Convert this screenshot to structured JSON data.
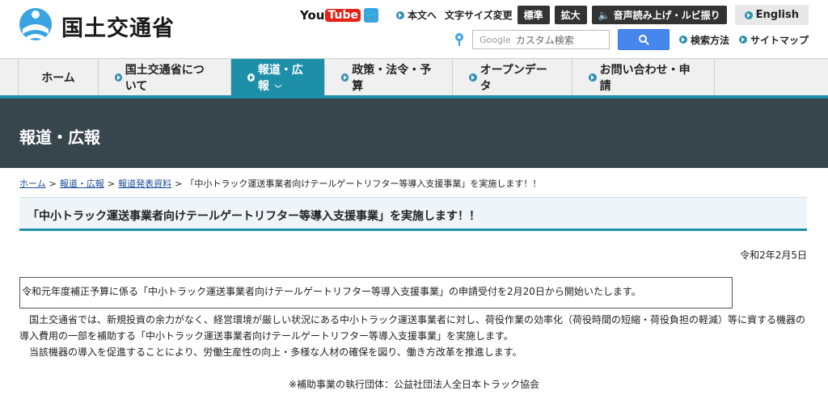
{
  "header": {
    "logo_text": "国土交通省",
    "youtube_you": "You",
    "youtube_tube": "Tube",
    "skip_to_content": "本文へ",
    "font_size_label": "文字サイズ変更",
    "font_standard": "標準",
    "font_large": "拡大",
    "speech_button": "音声読み上げ・ルビ振り",
    "english": "English",
    "search_brand": "Google",
    "search_placeholder": "カスタム検索",
    "search_method": "検索方法",
    "sitemap": "サイトマップ"
  },
  "nav": {
    "items": [
      {
        "label": "ホーム"
      },
      {
        "label": "国土交通省について"
      },
      {
        "label": "報道・広報"
      },
      {
        "label": "政策・法令・予算"
      },
      {
        "label": "オープンデータ"
      },
      {
        "label": "お問い合わせ・申請"
      }
    ],
    "active_chevron": "﹀"
  },
  "band": {
    "title": "報道・広報"
  },
  "breadcrumb": {
    "home": "ホーム",
    "press": "報道・広報",
    "releases": "報道発表資料",
    "current": "「中小トラック運送事業者向けテールゲートリフター等導入支援事業」を実施します！！",
    "separator": ">"
  },
  "article": {
    "title": "「中小トラック運送事業者向けテールゲートリフター等導入支援事業」を実施します！！",
    "date": "令和2年2月5日",
    "notice": "令和元年度補正予算に係る「中小トラック運送事業者向けテールゲートリフター等導入支援事業」の申請受付を2月20日から開始いたします。",
    "body_1": "　国土交通省では、新規投資の余力がなく、経営環境が厳しい状況にある中小トラック運送事業者に対し、荷役作業の効率化（荷役時間の短縮・荷役負担の軽減）等に資する機器の",
    "body_2": "導入費用の一部を補助する「中小トラック運送事業者向けテールゲートリフター等導入支援事業」を実施します。",
    "body_3": "　当該機器の導入を促進することにより、労働生産性の向上・多様な人材の確保を図り、働き方改革を推進します。",
    "footnote": "※補助事業の執行団体：公益社団法人全日本トラック協会"
  },
  "colors": {
    "accent": "#1d8fa8",
    "band": "#37454c",
    "search_button": "#4787ed"
  }
}
